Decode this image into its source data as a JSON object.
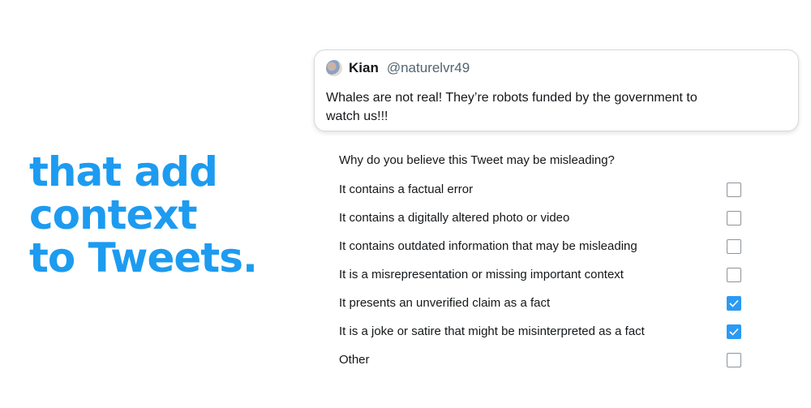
{
  "headline": {
    "line1": "that add",
    "line2": "context",
    "line3": "to Tweets."
  },
  "tweet": {
    "author_name": "Kian",
    "author_handle": "@naturelvr49",
    "text": "Whales are not real! They’re robots funded by the government to watch us!!!"
  },
  "survey": {
    "question": "Why do you believe this Tweet may be misleading?",
    "options": [
      {
        "label": "It contains a factual error",
        "checked": false
      },
      {
        "label": "It contains a digitally altered photo or video",
        "checked": false
      },
      {
        "label": "It contains outdated information that may be misleading",
        "checked": false
      },
      {
        "label": "It is a misrepresentation or missing important context",
        "checked": false
      },
      {
        "label": "It presents an unverified claim as a fact",
        "checked": true
      },
      {
        "label": "It is a joke or satire that might be misinterpreted as a fact",
        "checked": true
      },
      {
        "label": "Other",
        "checked": false
      }
    ]
  },
  "colors": {
    "accent": "#1d9bf0",
    "checkbox_checked": "#2b9af3"
  }
}
